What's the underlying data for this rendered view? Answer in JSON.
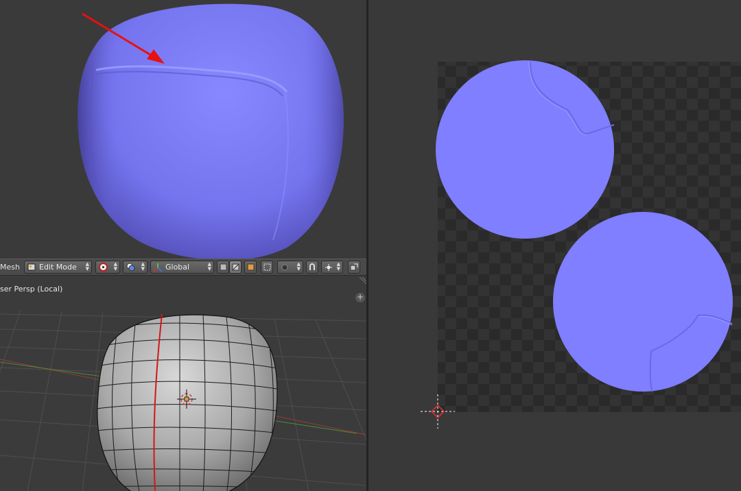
{
  "header": {
    "editor_label": "Mesh",
    "mode": {
      "label": "Edit Mode",
      "icon": "edit-mode-icon"
    },
    "pivot_icon": "pivot-point-icon",
    "shading_icon": "shading-icon",
    "orientation": {
      "label": "Global",
      "icon": "transform-orientation-icon"
    },
    "select_mode_icons": [
      "vertex-select-icon",
      "edge-select-icon",
      "face-select-icon"
    ],
    "extra_icons": [
      "occlude-geometry-icon",
      "proportional-editing-icon",
      "snap-icon",
      "snap-element-icon",
      "render-icon"
    ]
  },
  "viewport_bottom": {
    "view_label": "ser Persp (Local)"
  },
  "colors": {
    "normal_map": "#7f7fff",
    "viewport_bg": "#3a3a3a",
    "header_bg": "#4a4a4a",
    "seam": "#d01818",
    "annotation_arrow": "#e81010"
  }
}
